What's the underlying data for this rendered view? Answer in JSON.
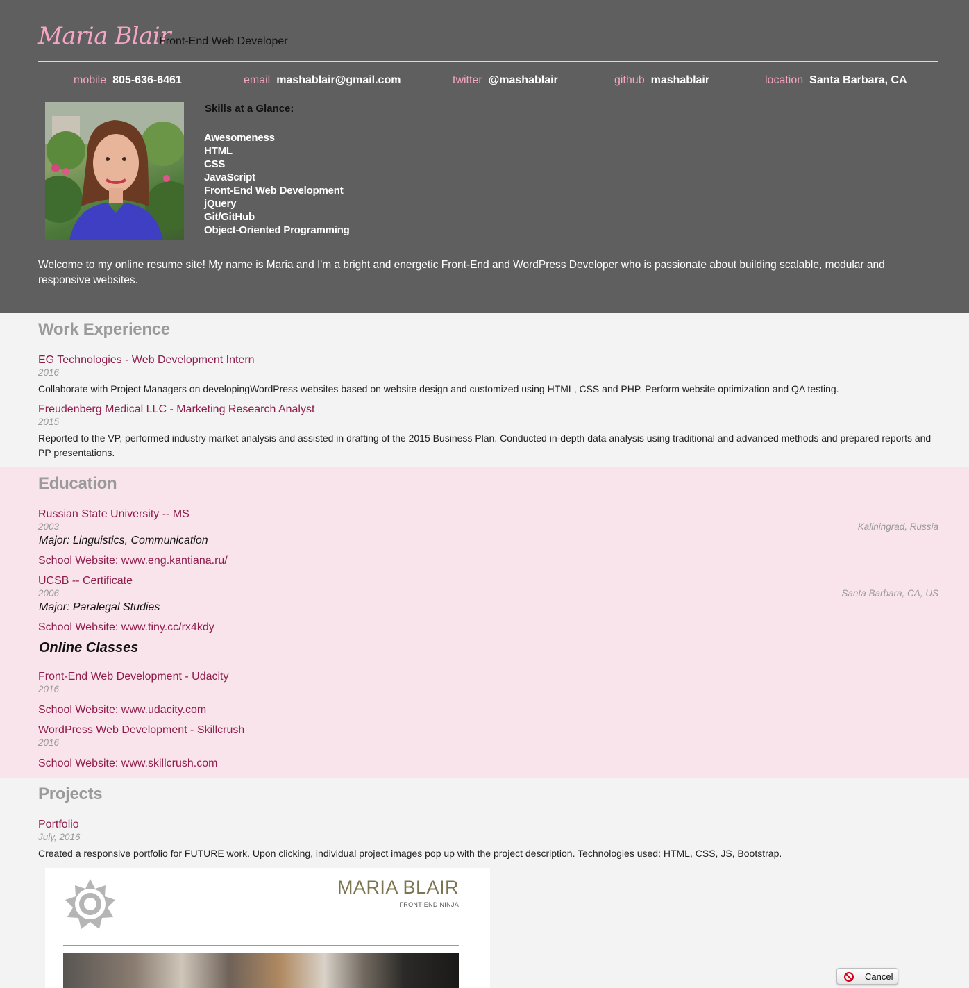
{
  "header": {
    "name": "Maria Blair",
    "role": "Front-End Web Developer",
    "contacts": [
      {
        "key": "mobile",
        "value": "805-636-6461"
      },
      {
        "key": "email",
        "value": "mashablair@gmail.com"
      },
      {
        "key": "twitter",
        "value": "@mashablair"
      },
      {
        "key": "github",
        "value": "mashablair"
      },
      {
        "key": "location",
        "value": "Santa Barbara, CA"
      }
    ],
    "skills_title": "Skills at a Glance:",
    "skills": [
      "Awesomeness",
      "HTML",
      "CSS",
      "JavaScript",
      "Front-End Web Development",
      "jQuery",
      "Git/GitHub",
      "Object-Oriented Programming"
    ],
    "welcome": " Welcome to my online resume site! My name is Maria and I'm a bright and energetic Front-End and WordPress Developer who is passionate about building scalable, modular and responsive websites."
  },
  "work": {
    "title": "Work Experience",
    "jobs": [
      {
        "title": "EG Technologies - Web Development Intern",
        "date": "2016",
        "description": "Collaborate with Project Managers on developingWordPress websites based on website design and customized using HTML, CSS and PHP. Perform website optimization and QA testing."
      },
      {
        "title": "Freudenberg Medical LLC - Marketing Research Analyst",
        "date": "2015",
        "description": "Reported to the VP, performed industry market analysis and assisted in drafting of the 2015 Business Plan. Conducted in-depth data analysis using traditional and advanced methods and prepared reports and PP presentations."
      }
    ]
  },
  "education": {
    "title": "Education",
    "schools": [
      {
        "title": "Russian State University -- MS",
        "date": "2003",
        "location": "Kaliningrad, Russia",
        "major": "Major: Linguistics, Communication",
        "website": "School Website: www.eng.kantiana.ru/"
      },
      {
        "title": "UCSB -- Certificate",
        "date": "2006",
        "location": "Santa Barbara, CA, US",
        "major": "Major: Paralegal Studies",
        "website": "School Website: www.tiny.cc/rx4kdy"
      }
    ],
    "online_title": "Online Classes",
    "online": [
      {
        "title": "Front-End Web Development - Udacity",
        "date": "2016",
        "website": "School Website: www.udacity.com"
      },
      {
        "title": "WordPress Web Development - Skillcrush",
        "date": "2016",
        "website": "School Website: www.skillcrush.com"
      }
    ]
  },
  "projects": {
    "title": "Projects",
    "items": [
      {
        "title": "Portfolio",
        "date": "July, 2016",
        "description": "Created a responsive portfolio for FUTURE work. Upon clicking, individual project images pop up with the project description. Technologies used: HTML, CSS, JS, Bootstrap.",
        "image_brand": "MARIA BLAIR",
        "image_sub": "FRONT-END NINJA"
      }
    ]
  },
  "dialog": {
    "cancel_label": "Cancel"
  },
  "colors": {
    "header_bg": "#5f5f5f",
    "accent_pink": "#f5a6c4",
    "link": "#8f1c4a",
    "education_bg": "#fae4ec",
    "section_title": "#9a9a9a"
  }
}
